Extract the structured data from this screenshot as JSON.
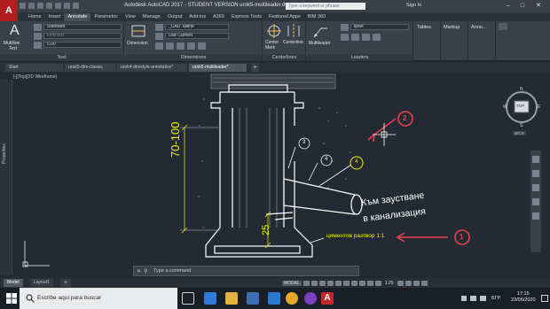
{
  "titlebar": {
    "title": "Autodesk AutoCAD 2017 - STUDENT VERSION    urok5-multileader.dwg",
    "search_placeholder": "Type a keyword or phrase",
    "signin": "Sign In"
  },
  "ribbon_tabs": [
    "Home",
    "Insert",
    "Annotate",
    "Parametric",
    "View",
    "Manage",
    "Output",
    "Add-ins",
    "A360",
    "Express Tools",
    "Featured Apps",
    "BIM 360"
  ],
  "active_tab": "Annotate",
  "text_panel": {
    "big_label_1": "Multiline",
    "big_label_2": "Text",
    "style": "Standard",
    "find_placeholder": "Find text",
    "height": "5.00",
    "title": "Text"
  },
  "dimensions_panel": {
    "big_label": "Dimension",
    "dimstyle": "_CAD Tailine",
    "use_current": "Use Current",
    "title": "Dimensions",
    "centermark": "Center Mark",
    "centerline": "Centerline"
  },
  "centerlines_panel": {
    "title": "Centerlines"
  },
  "leaders_panel": {
    "big_label": "Multileader",
    "style": "кран",
    "title": "Leaders"
  },
  "extra_panels": {
    "tables": "Tables",
    "markup": "Markup",
    "annotation": "Anno..."
  },
  "doc_tabs": [
    "Start",
    "urok5-dim-classic",
    "urok4-dimstyle-annotative*",
    "urok5-multileader*"
  ],
  "active_doc": "urok5-multileader*",
  "viewport_label": "[-][Top][2D Wireframe]",
  "properties_label": "Properties",
  "navcube": {
    "top": "TOP",
    "n": "N",
    "s": "S",
    "w": "W",
    "e": "E",
    "wcs": "WCS"
  },
  "drawing": {
    "dim_70_100": "70-100",
    "dim_25": "25",
    "mortar_label": "циментов разтвор 1:1",
    "sewer_line1": "Към заустване",
    "sewer_line2": "в канализация",
    "callouts": [
      "1",
      "2",
      "3",
      "4",
      "4"
    ]
  },
  "command_placeholder": "Type a command",
  "layout_tabs": [
    "Model",
    "Layout1"
  ],
  "status": {
    "model": "MODEL",
    "scale": "1:25"
  },
  "taskbar": {
    "search": "Escribe aquí para buscar",
    "lang": "БГР",
    "time": "17:15",
    "date": "23/06/2020"
  },
  "colors": {
    "accent_red": "#e8414e",
    "yellow_text": "#f1f200",
    "drawing_line": "#ffffff",
    "canvas": "#242a33"
  }
}
